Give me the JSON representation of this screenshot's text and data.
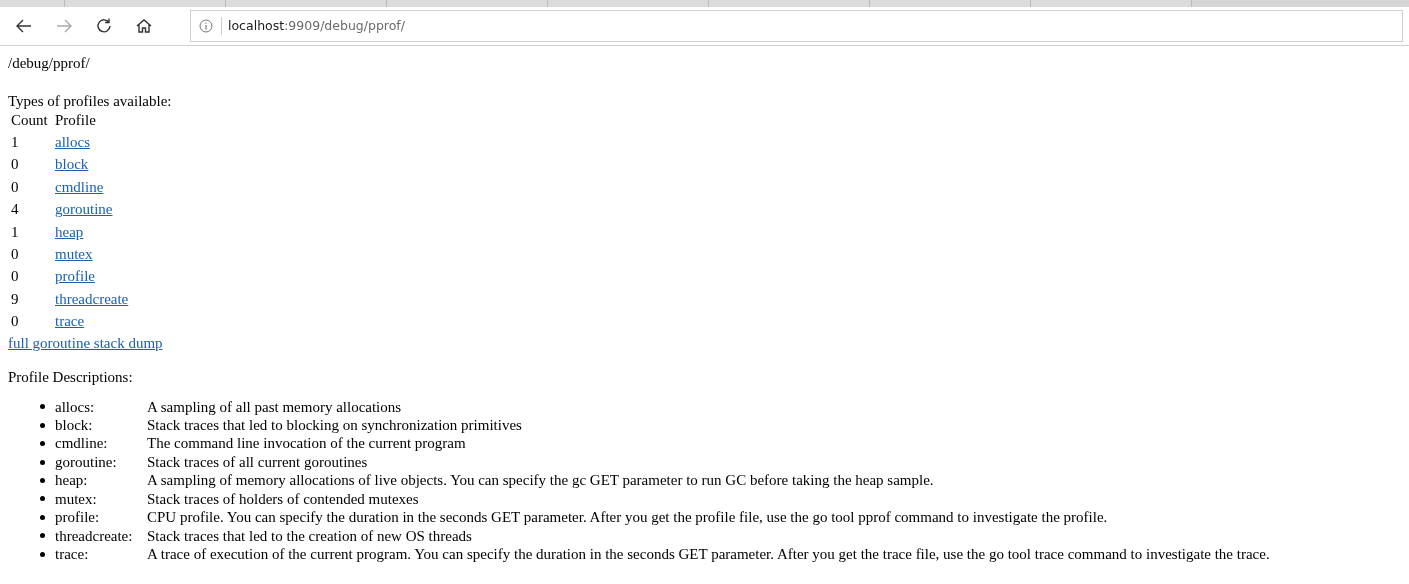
{
  "browser": {
    "address_bar": {
      "host": "localhost",
      "path": ":9909/debug/pprof/"
    }
  },
  "page": {
    "heading": "/debug/pprof/",
    "intro": "Types of profiles available:",
    "table": {
      "columns": [
        "Count",
        "Profile"
      ],
      "rows": [
        {
          "count": "1",
          "profile": "allocs"
        },
        {
          "count": "0",
          "profile": "block"
        },
        {
          "count": "0",
          "profile": "cmdline"
        },
        {
          "count": "4",
          "profile": "goroutine"
        },
        {
          "count": "1",
          "profile": "heap"
        },
        {
          "count": "0",
          "profile": "mutex"
        },
        {
          "count": "0",
          "profile": "profile"
        },
        {
          "count": "9",
          "profile": "threadcreate"
        },
        {
          "count": "0",
          "profile": "trace"
        }
      ]
    },
    "dump_link": "full goroutine stack dump",
    "descriptions_title": "Profile Descriptions:",
    "descriptions": [
      {
        "term": "allocs:",
        "text": "A sampling of all past memory allocations"
      },
      {
        "term": "block:",
        "text": "Stack traces that led to blocking on synchronization primitives"
      },
      {
        "term": "cmdline:",
        "text": "The command line invocation of the current program"
      },
      {
        "term": "goroutine:",
        "text": "Stack traces of all current goroutines"
      },
      {
        "term": "heap:",
        "text": "A sampling of memory allocations of live objects. You can specify the gc GET parameter to run GC before taking the heap sample."
      },
      {
        "term": "mutex:",
        "text": "Stack traces of holders of contended mutexes"
      },
      {
        "term": "profile:",
        "text": "CPU profile. You can specify the duration in the seconds GET parameter. After you get the profile file, use the go tool pprof command to investigate the profile."
      },
      {
        "term": "threadcreate:",
        "text": "Stack traces that led to the creation of new OS threads"
      },
      {
        "term": "trace:",
        "text": "A trace of execution of the current program. You can specify the duration in the seconds GET parameter. After you get the trace file, use the go tool trace command to investigate the trace."
      }
    ]
  }
}
